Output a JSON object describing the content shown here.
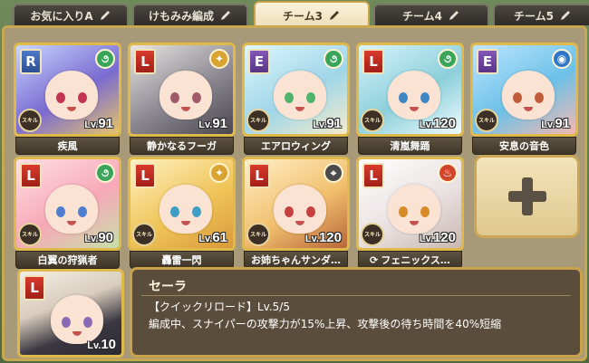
{
  "tabs": [
    {
      "label": "お気に入りA",
      "editable": true,
      "active": false
    },
    {
      "label": "けもみみ編成",
      "editable": true,
      "active": false
    },
    {
      "label": "チーム3",
      "editable": true,
      "active": true
    },
    {
      "label": "チーム4",
      "editable": true,
      "active": false
    },
    {
      "label": "チーム5",
      "editable": true,
      "active": false
    }
  ],
  "members": [
    {
      "name": "疾風",
      "rarity": "R",
      "level_prefix": "Lv.",
      "level": "91",
      "attribute_icon": "wind-icon",
      "has_skill_badge": true,
      "name_icon": ""
    },
    {
      "name": "静かなるフーガ",
      "rarity": "L",
      "level_prefix": "Lv.",
      "level": "91",
      "attribute_icon": "light-icon",
      "has_skill_badge": false,
      "name_icon": ""
    },
    {
      "name": "エアロウィング",
      "rarity": "E",
      "level_prefix": "Lv.",
      "level": "91",
      "attribute_icon": "wind-icon",
      "has_skill_badge": true,
      "name_icon": ""
    },
    {
      "name": "清嵐舞踊",
      "rarity": "L",
      "level_prefix": "Lv.",
      "level": "120",
      "attribute_icon": "wind-icon",
      "has_skill_badge": true,
      "name_icon": ""
    },
    {
      "name": "安息の音色",
      "rarity": "E",
      "level_prefix": "Lv.",
      "level": "91",
      "attribute_icon": "water-icon",
      "has_skill_badge": true,
      "name_icon": ""
    },
    {
      "name": "白翼の狩猟者",
      "rarity": "L",
      "level_prefix": "Lv.",
      "level": "90",
      "attribute_icon": "wind-icon",
      "has_skill_badge": true,
      "name_icon": ""
    },
    {
      "name": "轟雷一閃",
      "rarity": "L",
      "level_prefix": "Lv.",
      "level": "61",
      "attribute_icon": "light-icon",
      "has_skill_badge": true,
      "name_icon": ""
    },
    {
      "name": "お姉ちゃんサンダ…",
      "rarity": "L",
      "level_prefix": "Lv.",
      "level": "120",
      "attribute_icon": "crosshair-icon",
      "has_skill_badge": true,
      "name_icon": ""
    },
    {
      "name": "フェニックス…",
      "rarity": "L",
      "level_prefix": "Lv.",
      "level": "120",
      "attribute_icon": "fire-icon",
      "has_skill_badge": true,
      "name_icon": "refresh-icon"
    }
  ],
  "empty_slot_icon": "plus-icon",
  "leader": {
    "rarity": "L",
    "level_prefix": "Lv.",
    "level": "10"
  },
  "description": {
    "name": "セーラ",
    "skill": "【クイックリロード】Lv.5/5",
    "effect": "編成中、スナイパーの攻撃力が15%上昇、攻撃後の待ち時間を40%短縮"
  },
  "skill_badge_text": "スキル\nマート",
  "colors": {
    "frame_gold": "#e0b94b",
    "panel_bg": "#a89a79",
    "tab_active_bg": "#fdf4dd",
    "nameplate_bg": "#4b4233"
  }
}
